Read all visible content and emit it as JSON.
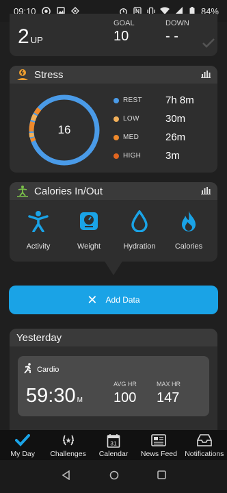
{
  "status_bar": {
    "time": "09:10",
    "battery": "84%"
  },
  "floors": {
    "up_value": "2",
    "up_unit": "UP",
    "goal_label": "GOAL",
    "goal_value": "10",
    "down_label": "DOWN",
    "down_value": "- -"
  },
  "stress": {
    "title": "Stress",
    "score": "16",
    "levels": [
      {
        "name": "REST",
        "value": "7h 8m",
        "color": "#4a9be8"
      },
      {
        "name": "LOW",
        "value": "30m",
        "color": "#f2b05a"
      },
      {
        "name": "MED",
        "value": "26m",
        "color": "#ef8a2c"
      },
      {
        "name": "HIGH",
        "value": "3m",
        "color": "#e0651f"
      }
    ]
  },
  "calories": {
    "title": "Calories In/Out",
    "items": [
      {
        "label": "Activity",
        "icon": "activity-icon"
      },
      {
        "label": "Weight",
        "icon": "scale-icon"
      },
      {
        "label": "Hydration",
        "icon": "drop-icon"
      },
      {
        "label": "Calories",
        "icon": "flame-icon"
      }
    ]
  },
  "add_data": {
    "label": "Add Data"
  },
  "yesterday": {
    "title": "Yesterday",
    "activity": {
      "name": "Cardio",
      "duration": "59:30",
      "duration_unit": "M",
      "avg_hr_label": "AVG HR",
      "avg_hr": "100",
      "max_hr_label": "MAX HR",
      "max_hr": "147"
    }
  },
  "bottom_nav": [
    {
      "label": "My Day",
      "icon": "check-icon"
    },
    {
      "label": "Challenges",
      "icon": "laurel-icon"
    },
    {
      "label": "Calendar",
      "icon": "calendar-icon"
    },
    {
      "label": "News Feed",
      "icon": "newsfeed-icon"
    },
    {
      "label": "Notifications",
      "icon": "inbox-icon"
    }
  ],
  "calendar_day": "31",
  "colors": {
    "accent": "#1aa3e6",
    "card": "#2e2e2e",
    "card_header": "#3a3a3a"
  }
}
